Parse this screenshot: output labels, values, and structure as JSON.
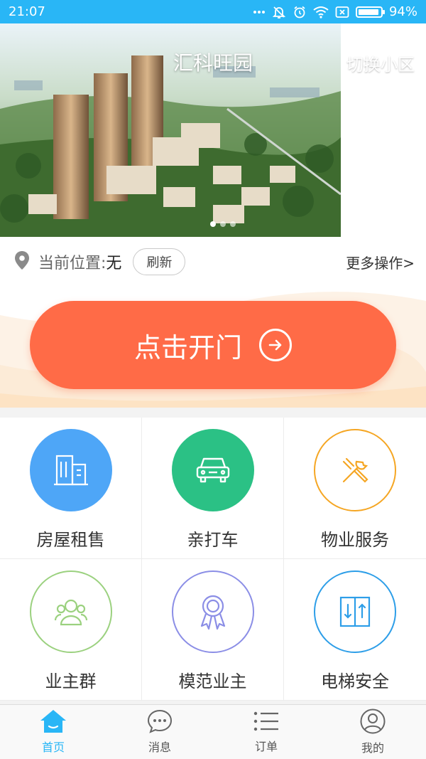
{
  "status_bar": {
    "time": "21:07",
    "battery": "94%",
    "battery_level": 0.94
  },
  "banner": {
    "title": "汇科旺园",
    "switch_label": "切换小区",
    "slide_count": 3,
    "active_slide": 0
  },
  "location": {
    "label": "当前位置:",
    "value": "无",
    "refresh_label": "刷新",
    "more_label": "更多操作>"
  },
  "door": {
    "label": "点击开门"
  },
  "grid": {
    "items": [
      {
        "label": "房屋租售",
        "icon": "building-icon",
        "color": "#4ea6f7"
      },
      {
        "label": "亲打车",
        "icon": "car-icon",
        "color": "#2bc185"
      },
      {
        "label": "物业服务",
        "icon": "tools-icon",
        "color": "#f5a623"
      },
      {
        "label": "业主群",
        "icon": "group-icon",
        "color": "#9bd17f"
      },
      {
        "label": "模范业主",
        "icon": "medal-icon",
        "color": "#8b8ee6"
      },
      {
        "label": "电梯安全",
        "icon": "elevator-icon",
        "color": "#2d9ee8"
      }
    ]
  },
  "tabbar": {
    "tabs": [
      {
        "label": "首页",
        "icon": "home-icon",
        "active": true
      },
      {
        "label": "消息",
        "icon": "message-icon",
        "active": false
      },
      {
        "label": "订单",
        "icon": "list-icon",
        "active": false
      },
      {
        "label": "我的",
        "icon": "profile-icon",
        "active": false
      }
    ]
  },
  "colors": {
    "accent": "#29b6f6",
    "door_button": "#ff6b47"
  }
}
